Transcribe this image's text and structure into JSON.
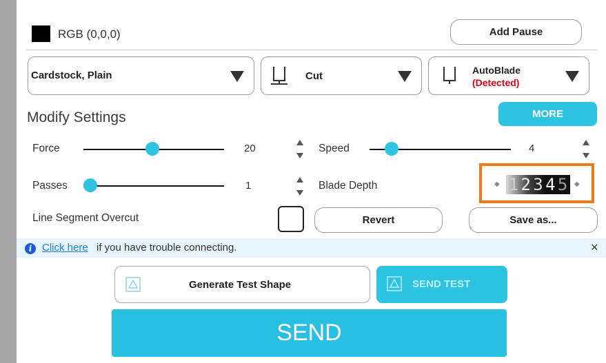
{
  "color": {
    "swatch": "#000000",
    "label": "RGB (0,0,0)"
  },
  "toolbar": {
    "add_pause_label": "Add Pause"
  },
  "dropdowns": {
    "material": {
      "value": "Cardstock, Plain"
    },
    "action": {
      "value": "Cut"
    },
    "tool": {
      "value": "AutoBlade",
      "status": "(Detected)"
    }
  },
  "modify": {
    "title": "Modify Settings",
    "more_label": "MORE",
    "force": {
      "label": "Force",
      "value": "20"
    },
    "speed": {
      "label": "Speed",
      "value": "4"
    },
    "passes": {
      "label": "Passes",
      "value": "1"
    },
    "blade_depth": {
      "label": "Blade Depth",
      "digits": [
        "1",
        "2",
        "3",
        "4",
        "5"
      ]
    },
    "overcut": {
      "label": "Line Segment Overcut",
      "checked": false
    },
    "revert_label": "Revert",
    "save_as_label": "Save as..."
  },
  "info": {
    "link_text": "Click here",
    "text": " if you have trouble connecting.",
    "close": "×"
  },
  "actions": {
    "generate_label": "Generate Test Shape",
    "send_test_label": "SEND TEST",
    "send_label": "SEND"
  },
  "colors": {
    "accent": "#2fc3e2",
    "highlight": "#f07a1a",
    "warning_text": "#e0001b",
    "link": "#1f7fd6"
  }
}
